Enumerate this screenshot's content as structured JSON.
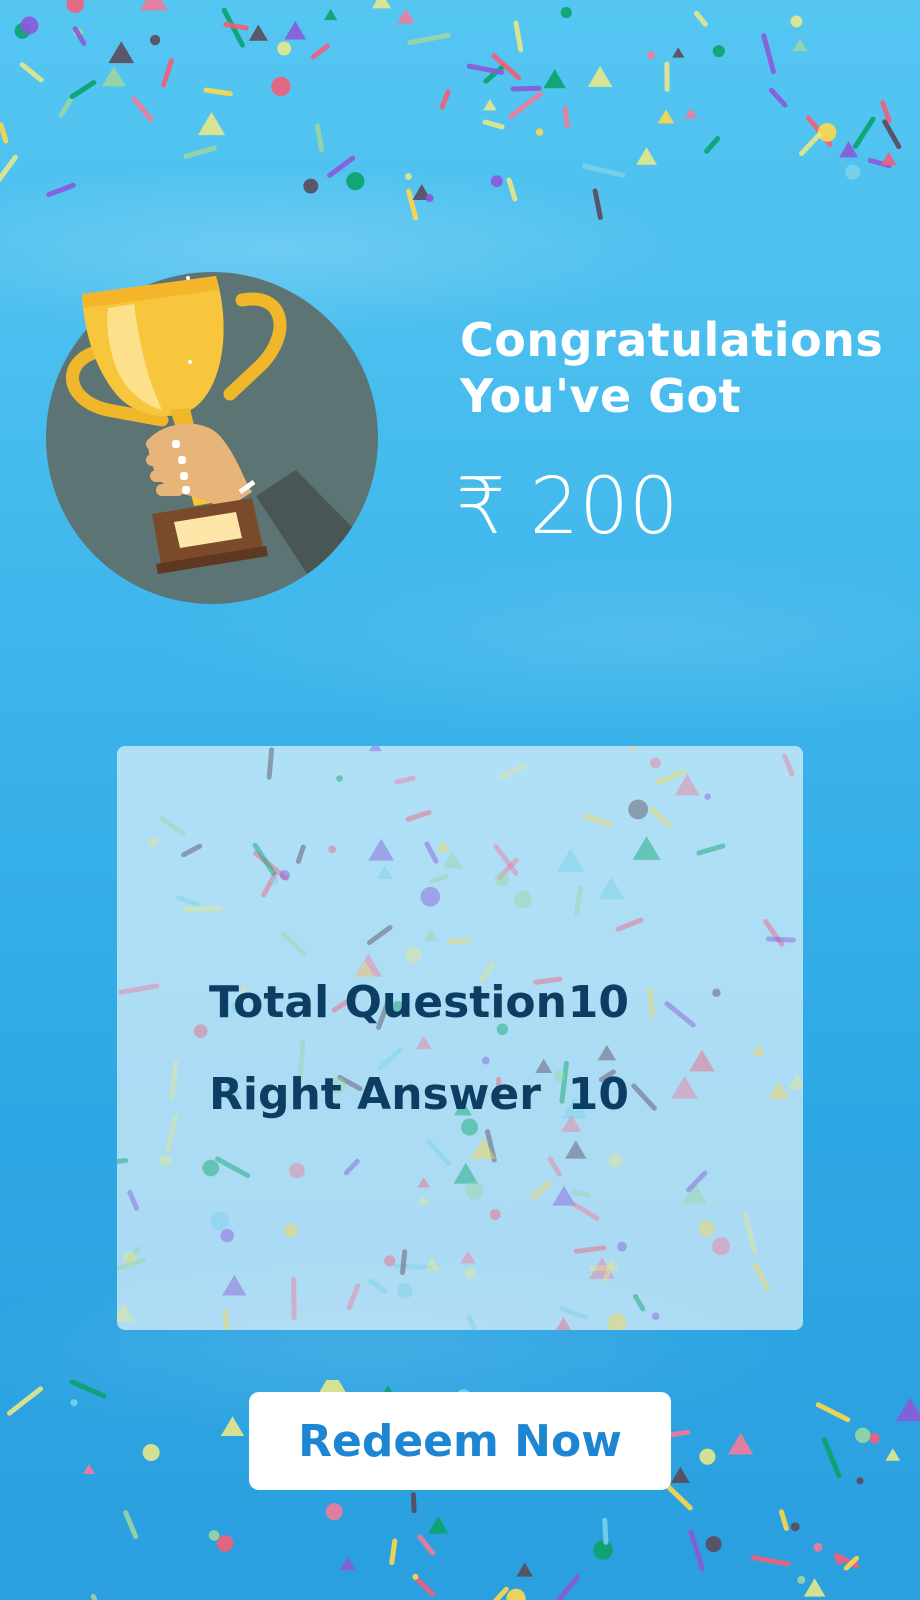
{
  "header": {
    "title": "Congratulations\nYou've Got"
  },
  "reward": {
    "currency_symbol": "₹",
    "amount": "200"
  },
  "stats": [
    {
      "label": "Total Question",
      "value": "10"
    },
    {
      "label": "Right  Answer",
      "value": "10"
    }
  ],
  "actions": {
    "redeem_label": "Redeem Now"
  },
  "icons": {
    "trophy": "trophy-in-hand-icon",
    "confetti": "confetti-decoration"
  },
  "colors": {
    "background": "#3ab3ea",
    "card": "#c9ebf9",
    "stats_text": "#0c3d63",
    "button_text": "#1d86d2",
    "button_bg": "#ffffff",
    "trophy_circle": "#5c7474",
    "trophy_gold": "#f7c63c"
  }
}
